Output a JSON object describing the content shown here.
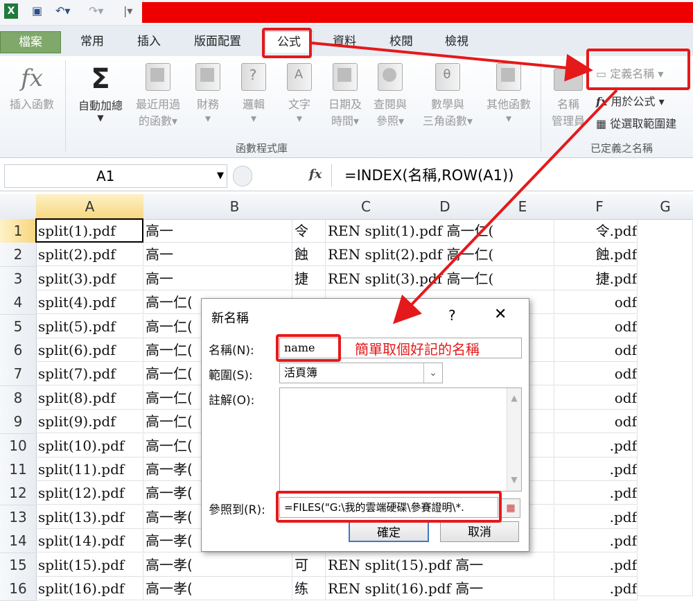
{
  "quick_access": {
    "undo_icon": "undo-icon",
    "redo_icon": "redo-icon"
  },
  "tabs": [
    {
      "label": "檔案"
    },
    {
      "label": "常用"
    },
    {
      "label": "插入"
    },
    {
      "label": "版面配置"
    },
    {
      "label": "公式"
    },
    {
      "label": "資料"
    },
    {
      "label": "校閱"
    },
    {
      "label": "檢視"
    }
  ],
  "ribbon": {
    "insert_function": "插入函數",
    "autosum": "自動加總",
    "recent_1": "最近用過",
    "recent_2": "的函數",
    "financial": "財務",
    "logical": "邏輯",
    "text": "文字",
    "datetime_1": "日期及",
    "datetime_2": "時間",
    "lookup_1": "查閱與",
    "lookup_2": "參照",
    "math_1": "數學與",
    "math_2": "三角函數",
    "other": "其他函數",
    "group_function_library": "函數程式庫",
    "name_manager_1": "名稱",
    "name_manager_2": "管理員",
    "define_name": "定義名稱",
    "use_in_formula": "用於公式",
    "create_from_selection": "從選取範圍建",
    "group_defined_names": "已定義之名稱"
  },
  "formula_bar": {
    "name_box": "A1",
    "fx": "fx",
    "formula": "=INDEX(名稱,ROW(A1))"
  },
  "grid": {
    "columns": [
      "A",
      "B",
      "C",
      "D",
      "E",
      "F",
      "G"
    ],
    "rows": [
      {
        "n": "1",
        "a": "split(1).pdf",
        "b": "高一",
        "b2": "令",
        "c": "REN split(1).pdf 高一仁(",
        "f": "令.pdf"
      },
      {
        "n": "2",
        "a": "split(2).pdf",
        "b": "高一",
        "b2": "蝕",
        "c": "REN split(2).pdf 高一仁(",
        "f": "蝕.pdf"
      },
      {
        "n": "3",
        "a": "split(3).pdf",
        "b": "高一",
        "b2": "捷",
        "c": "REN split(3).pdf 高一仁(",
        "f": "捷.pdf"
      },
      {
        "n": "4",
        "a": "split(4).pdf",
        "b": "高一仁(",
        "b2": "",
        "c": "",
        "f": "odf"
      },
      {
        "n": "5",
        "a": "split(5).pdf",
        "b": "高一仁(",
        "b2": "",
        "c": "",
        "f": "odf"
      },
      {
        "n": "6",
        "a": "split(6).pdf",
        "b": "高一仁(",
        "b2": "",
        "c": "",
        "f": "odf"
      },
      {
        "n": "7",
        "a": "split(7).pdf",
        "b": "高一仁(",
        "b2": "",
        "c": "",
        "f": "odf"
      },
      {
        "n": "8",
        "a": "split(8).pdf",
        "b": "高一仁(",
        "b2": "",
        "c": "",
        "f": "odf"
      },
      {
        "n": "9",
        "a": "split(9).pdf",
        "b": "高一仁(",
        "b2": "",
        "c": "",
        "f": "odf"
      },
      {
        "n": "10",
        "a": "split(10).pdf",
        "b": "高一仁(",
        "b2": "",
        "c": "",
        "f": ".pdf"
      },
      {
        "n": "11",
        "a": "split(11).pdf",
        "b": "高一孝(",
        "b2": "",
        "c": "",
        "f": ".pdf"
      },
      {
        "n": "12",
        "a": "split(12).pdf",
        "b": "高一孝(",
        "b2": "",
        "c": "",
        "f": ".pdf"
      },
      {
        "n": "13",
        "a": "split(13).pdf",
        "b": "高一孝(",
        "b2": "",
        "c": "",
        "f": ".pdf"
      },
      {
        "n": "14",
        "a": "split(14).pdf",
        "b": "高一孝(",
        "b2": "",
        "c": "",
        "f": ".pdf"
      },
      {
        "n": "15",
        "a": "split(15).pdf",
        "b": "高一孝(",
        "b2": "可",
        "c": "REN split(15).pdf 高一",
        "f": ".pdf"
      },
      {
        "n": "16",
        "a": "split(16).pdf",
        "b": "高一孝(",
        "b2": "练",
        "c": "REN split(16).pdf 高一",
        "f": ".pdf"
      }
    ]
  },
  "dialog": {
    "title": "新名稱",
    "help": "?",
    "close": "✕",
    "name_label": "名稱(N):",
    "name_value": "name",
    "scope_label": "範圍(S):",
    "scope_value": "活頁簿",
    "comment_label": "註解(O):",
    "refers_label": "參照到(R):",
    "refers_value": "=FILES(\"G:\\我的雲端硬碟\\參賽證明\\*.",
    "ok": "確定",
    "cancel": "取消"
  },
  "annotation": {
    "text": "簡單取個好記的名稱",
    "color": "#e5191a"
  }
}
